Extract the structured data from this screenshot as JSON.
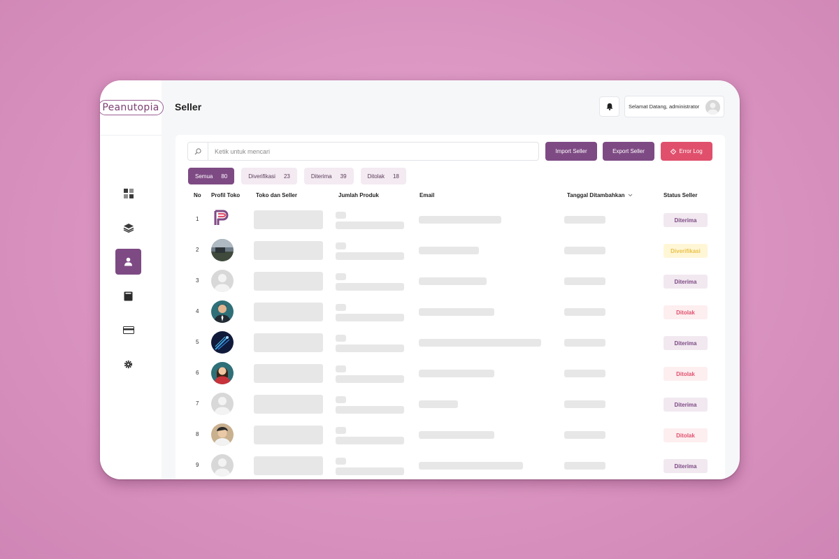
{
  "app": {
    "logo": "Peanutopia",
    "page_title": "Seller"
  },
  "header": {
    "welcome": "Selamat Datang, administrator"
  },
  "search": {
    "placeholder": "Ketik untuk mencari"
  },
  "buttons": {
    "import": "Import Seller",
    "export": "Export Seller",
    "error_log": "Error Log"
  },
  "filters": [
    {
      "label": "Semua",
      "count": "80"
    },
    {
      "label": "Diverifikasi",
      "count": "23"
    },
    {
      "label": "Diterima",
      "count": "39"
    },
    {
      "label": "Ditolak",
      "count": "18"
    }
  ],
  "table": {
    "headers": {
      "no": "No",
      "profile": "Profil Toko",
      "store": "Toko dan Seller",
      "products": "Jumlah Produk",
      "email": "Email",
      "date": "Tanggal Ditambahkan",
      "status": "Status Seller"
    },
    "rows": [
      {
        "no": "1",
        "avatar": "p-logo",
        "status": "Diterima",
        "kind": "diterima"
      },
      {
        "no": "2",
        "avatar": "photo-outdoor",
        "status": "Diverifikasi",
        "kind": "diverifikasi"
      },
      {
        "no": "3",
        "avatar": "default-person-icon",
        "status": "Diterima",
        "kind": "diterima"
      },
      {
        "no": "4",
        "avatar": "man-suit",
        "status": "Ditolak",
        "kind": "ditolak"
      },
      {
        "no": "5",
        "avatar": "dark-blue-graphic",
        "status": "Diterima",
        "kind": "diterima"
      },
      {
        "no": "6",
        "avatar": "woman-red",
        "status": "Ditolak",
        "kind": "ditolak"
      },
      {
        "no": "7",
        "avatar": "default-person-icon",
        "status": "Diterima",
        "kind": "diterima"
      },
      {
        "no": "8",
        "avatar": "person-cap",
        "status": "Ditolak",
        "kind": "ditolak"
      },
      {
        "no": "9",
        "avatar": "default-person-icon",
        "status": "Diterima",
        "kind": "diterima"
      }
    ]
  },
  "nav": [
    {
      "icon": "dashboard-icon",
      "active": false
    },
    {
      "icon": "layers-icon",
      "active": false
    },
    {
      "icon": "user-icon",
      "active": true
    },
    {
      "icon": "book-icon",
      "active": false
    },
    {
      "icon": "card-icon",
      "active": false
    },
    {
      "icon": "gear-icon",
      "active": false
    }
  ],
  "colors": {
    "accent": "#7e4a84",
    "danger": "#e0506c",
    "warning": "#e9c14a"
  }
}
